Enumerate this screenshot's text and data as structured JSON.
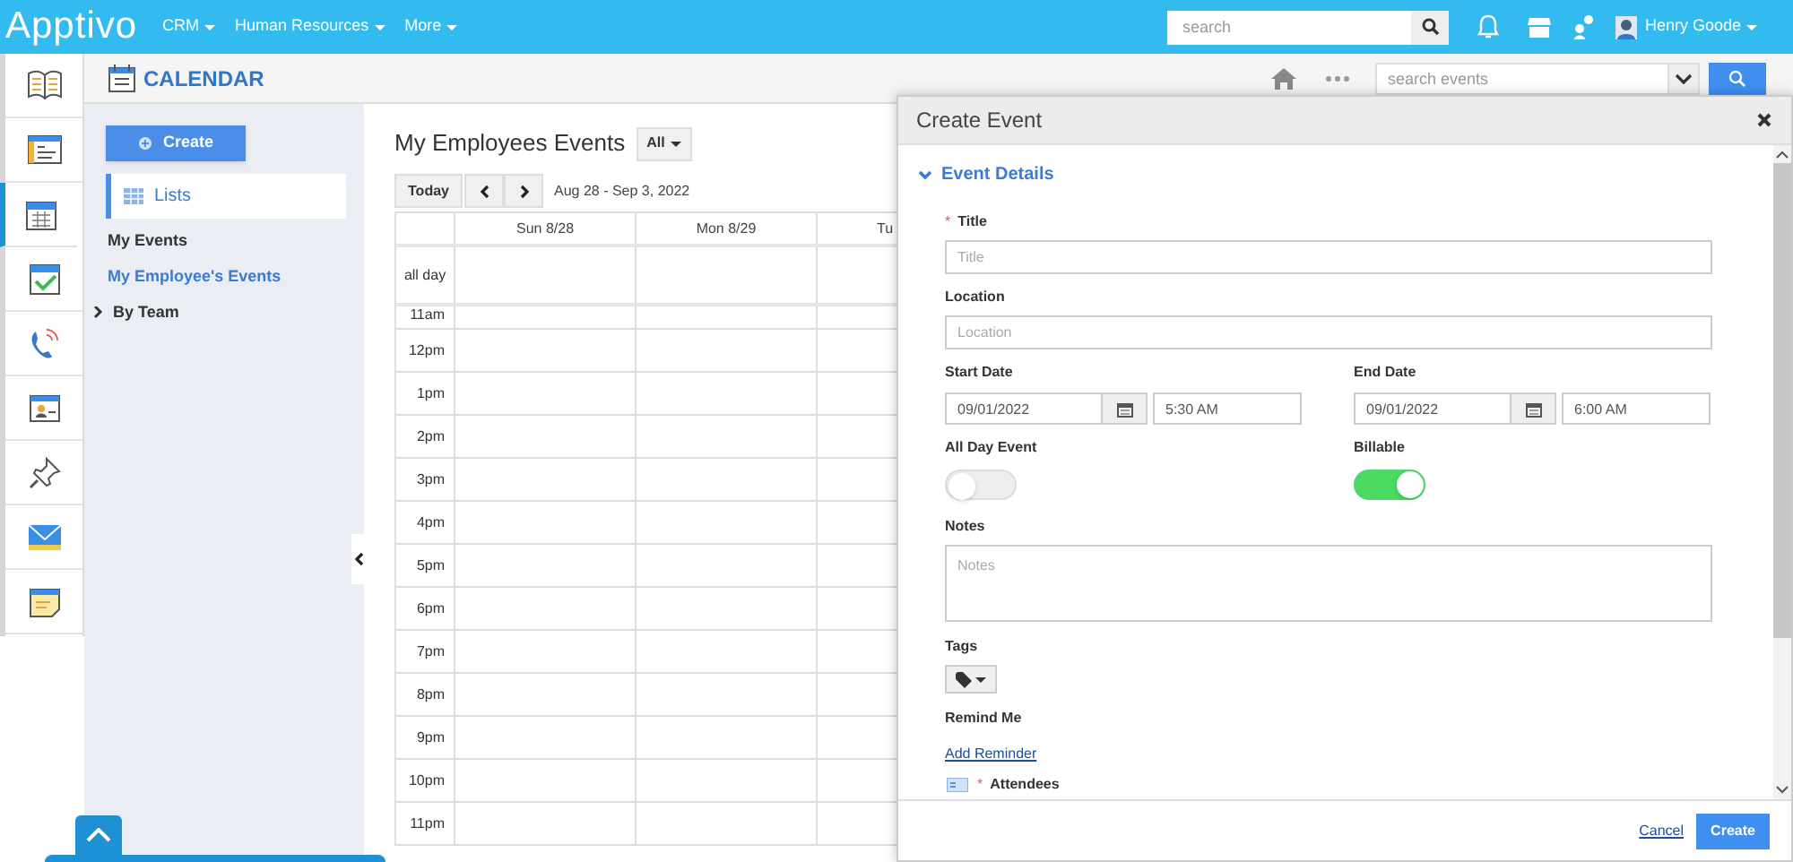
{
  "top_nav": {
    "logo": "Apptivo",
    "menus": [
      {
        "label": "CRM"
      },
      {
        "label": "Human Resources"
      },
      {
        "label": "More"
      }
    ],
    "search": {
      "placeholder": "search"
    },
    "user": {
      "name": "Henry Goode"
    }
  },
  "rail": [
    {
      "selected": false
    },
    {
      "selected": false
    },
    {
      "selected": true
    },
    {
      "selected": false
    },
    {
      "selected": false
    },
    {
      "selected": false
    },
    {
      "selected": false
    },
    {
      "selected": false
    },
    {
      "selected": false
    }
  ],
  "app_header": {
    "title": "CALENDAR",
    "search": {
      "placeholder": "search events"
    }
  },
  "sidebar": {
    "create_button": "Create",
    "lists_header": "Lists",
    "items": [
      {
        "label": "My Events",
        "selected": false
      },
      {
        "label": "My Employee's Events",
        "selected": true
      }
    ],
    "by_team": {
      "label": "By Team",
      "expanded": false
    }
  },
  "calendar": {
    "title": "My Employees Events",
    "filter": "All",
    "today_button": "Today",
    "range": "Aug 28 - Sep 3, 2022",
    "columns": [
      "Sun 8/28",
      "Mon 8/29",
      "Tu"
    ],
    "all_day_label": "all day",
    "times": [
      "11am",
      "12pm",
      "1pm",
      "2pm",
      "3pm",
      "4pm",
      "5pm",
      "6pm",
      "7pm",
      "8pm",
      "9pm",
      "10pm",
      "11pm"
    ]
  },
  "modal": {
    "title": "Create Event",
    "section": {
      "label": "Event Details",
      "expanded": true
    },
    "title_field": {
      "label": "Title",
      "required_mark": "*",
      "placeholder": "Title"
    },
    "location": {
      "label": "Location",
      "placeholder": "Location"
    },
    "start": {
      "label": "Start Date",
      "date": "09/01/2022",
      "time": "5:30 AM"
    },
    "end": {
      "label": "End Date",
      "date": "09/01/2022",
      "time": "6:00 AM"
    },
    "all_day": {
      "label": "All Day Event",
      "on": false
    },
    "billable": {
      "label": "Billable",
      "on": true
    },
    "notes": {
      "label": "Notes",
      "placeholder": "Notes"
    },
    "tags": {
      "label": "Tags"
    },
    "remind": {
      "label": "Remind Me",
      "link": "Add Reminder"
    },
    "attendees": {
      "label": "Attendees",
      "required_mark": "*"
    },
    "cancel": "Cancel",
    "submit": "Create"
  }
}
